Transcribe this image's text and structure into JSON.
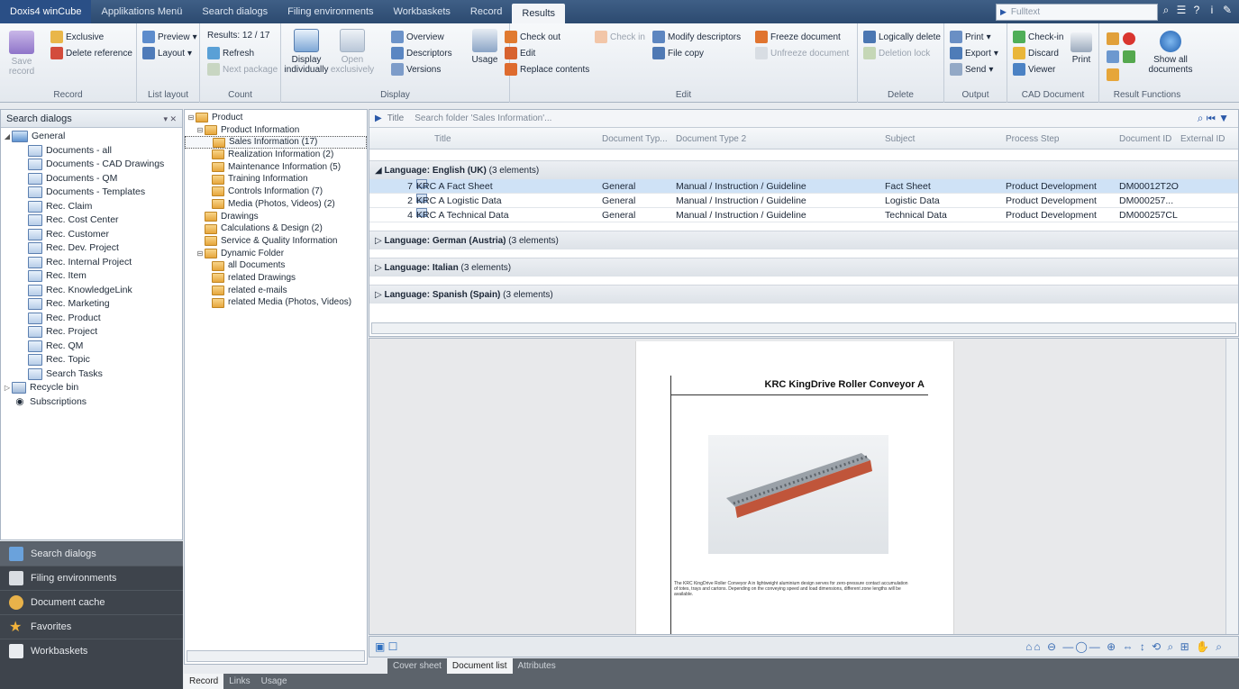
{
  "app": {
    "title": "Doxis4 winCube"
  },
  "menu": {
    "tabs": [
      "Applikations Menü",
      "Search dialogs",
      "Filing environments",
      "Workbaskets",
      "Record",
      "Results"
    ],
    "active": "Results",
    "fulltext_placeholder": "Fulltext"
  },
  "ribbon": {
    "record": {
      "label": "Record",
      "save": "Save record",
      "exclusive": "Exclusive",
      "delete_reference": "Delete reference"
    },
    "list_layout": {
      "label": "List layout",
      "preview": "Preview",
      "layout": "Layout"
    },
    "count": {
      "label": "Count",
      "results": "Results: 12 / 17",
      "refresh": "Refresh",
      "next_package": "Next package"
    },
    "display": {
      "label": "Display",
      "display_individually": "Display individually",
      "open_exclusively": "Open exclusively",
      "overview": "Overview",
      "descriptors": "Descriptors",
      "versions": "Versions",
      "usage": "Usage"
    },
    "edit": {
      "label": "Edit",
      "check_out": "Check out",
      "check_in": "Check in",
      "edit": "Edit",
      "replace_contents": "Replace contents",
      "modify_descriptors": "Modify descriptors",
      "file_copy": "File copy",
      "freeze_document": "Freeze document",
      "unfreeze_document": "Unfreeze document"
    },
    "delete": {
      "label": "Delete",
      "logically_delete": "Logically delete",
      "deletion_lock": "Deletion lock"
    },
    "output": {
      "label": "Output",
      "print": "Print",
      "export": "Export",
      "send": "Send"
    },
    "cad": {
      "label": "CAD Document",
      "check_in": "Check-in",
      "discard": "Discard",
      "viewer": "Viewer",
      "print": "Print"
    },
    "result_functions": {
      "label": "Result Functions",
      "show_all": "Show all documents"
    }
  },
  "search_dialogs": {
    "header": "Search dialogs",
    "root": "General",
    "items": [
      "Documents - all",
      "Documents - CAD Drawings",
      "Documents - QM",
      "Documents - Templates",
      "Rec. Claim",
      "Rec. Cost Center",
      "Rec. Customer",
      "Rec. Dev. Project",
      "Rec. Internal Project",
      "Rec. Item",
      "Rec. KnowledgeLink",
      "Rec. Marketing",
      "Rec. Product",
      "Rec. Project",
      "Rec. QM",
      "Rec. Topic",
      "Search Tasks"
    ],
    "recycle_bin": "Recycle bin",
    "subscriptions": "Subscriptions"
  },
  "left_nav": [
    "Search dialogs",
    "Filing environments",
    "Document cache",
    "Favorites",
    "Workbaskets"
  ],
  "record_tree": {
    "product": "Product",
    "product_information": "Product Information",
    "children": [
      "Sales Information (17)",
      "Realization Information (2)",
      "Maintenance Information (5)",
      "Training Information",
      "Controls Information (7)",
      "Media (Photos, Videos) (2)"
    ],
    "drawings": "Drawings",
    "calculations": "Calculations & Design (2)",
    "service": "Service & Quality Information",
    "dynamic_folder": "Dynamic Folder",
    "dynamic_children": [
      "all Documents",
      "related Drawings",
      "related e-mails",
      "related Media (Photos, Videos)"
    ]
  },
  "bottom_tabs": [
    "Record",
    "Links",
    "Usage"
  ],
  "results": {
    "search_label": "Title",
    "search_placeholder": "Search folder 'Sales Information'...",
    "columns": [
      "Title",
      "Document Typ...",
      "Document Type 2",
      "Subject",
      "Process Step",
      "Document ID",
      "External ID"
    ],
    "groups": [
      {
        "label": "Language: English (UK)",
        "count": "(3 elements)",
        "expanded": true,
        "rows": [
          {
            "num": "7",
            "title": "KRC A Fact Sheet",
            "type": "General",
            "type2": "Manual / Instruction / Guideline",
            "subject": "Fact Sheet",
            "step": "Product Development",
            "id": "DM00012T2O"
          },
          {
            "num": "2",
            "title": "KRC A Logistic Data",
            "type": "General",
            "type2": "Manual / Instruction / Guideline",
            "subject": "Logistic Data",
            "step": "Product Development",
            "id": "DM000257..."
          },
          {
            "num": "4",
            "title": "KRC A Technical Data",
            "type": "General",
            "type2": "Manual / Instruction / Guideline",
            "subject": "Technical Data",
            "step": "Product Development",
            "id": "DM000257CL"
          }
        ]
      },
      {
        "label": "Language: German (Austria)",
        "count": "(3 elements)",
        "expanded": false
      },
      {
        "label": "Language: Italian",
        "count": "(3 elements)",
        "expanded": false
      },
      {
        "label": "Language: Spanish (Spain)",
        "count": "(3 elements)",
        "expanded": false
      }
    ]
  },
  "preview": {
    "title": "KRC KingDrive Roller Conveyor A",
    "text": "The KRC KingDrive Roller Conveyor A in lightweight aluminium design serves for zero-pressure contact accumulation of totes, trays and cartons. Depending on the conveying speed and load dimensions, different zone lengths will be available.",
    "tabs": [
      "Cover sheet",
      "Document list",
      "Attributes"
    ],
    "active_tab": "Document list"
  }
}
